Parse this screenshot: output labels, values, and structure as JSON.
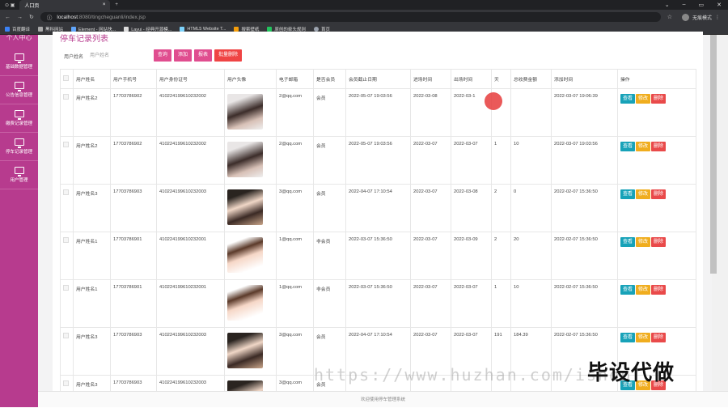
{
  "browser": {
    "tab_title": "人口页",
    "url_host": "localhost",
    "url_rest": ":8080/tingcheguanli/index.jsp",
    "profile_label": "无痕模式",
    "bookmarks": [
      "百度翻译",
      "黑科网站",
      "Element - 网站快...",
      "Layui - 经典开源模...",
      "HTML5 Website T...",
      "搜索壁纸",
      "原创的牵头规则",
      "首页"
    ]
  },
  "sidebar": {
    "top_label": "个人中心",
    "items": [
      {
        "label": "基础数据管理"
      },
      {
        "label": "公告信息管理"
      },
      {
        "label": "缴费记录管理"
      },
      {
        "label": "停车记录管理"
      },
      {
        "label": "用户管理"
      }
    ]
  },
  "page": {
    "title": "停车记录列表",
    "search_label": "用户姓名",
    "search_placeholder": "用户姓名",
    "buttons": {
      "search": "查询",
      "add": "添加",
      "report": "报表",
      "batch_delete": "批量删除"
    }
  },
  "table": {
    "headers": [
      "用户姓名",
      "用户手机号",
      "用户身份证号",
      "用户头像",
      "电子邮箱",
      "是否会员",
      "会员截止日期",
      "进场时间",
      "出场时间",
      "天",
      "总收费金额",
      "添加时间",
      "操作"
    ],
    "row_actions": {
      "view": "查看",
      "edit": "修改",
      "delete": "删除"
    },
    "rows": [
      {
        "name": "用户姓名2",
        "phone": "17703786902",
        "idcard": "410224199610232002",
        "avatar": "ph1",
        "email": "2@qq.com",
        "member": "会员",
        "member_end": "2022-05-07 19:03:56",
        "enter": "2022-03-08",
        "exit": "2022-03-1",
        "days": "",
        "fee": "",
        "added": "2022-03-07 19:06:39"
      },
      {
        "name": "用户姓名2",
        "phone": "17703786902",
        "idcard": "410224199610232002",
        "avatar": "ph1",
        "email": "2@qq.com",
        "member": "会员",
        "member_end": "2022-05-07 19:03:56",
        "enter": "2022-03-07",
        "exit": "2022-03-07",
        "days": "1",
        "fee": "10",
        "added": "2022-03-07 19:03:56"
      },
      {
        "name": "用户姓名3",
        "phone": "17703786903",
        "idcard": "410224199610232003",
        "avatar": "ph2",
        "email": "3@qq.com",
        "member": "会员",
        "member_end": "2022-04-07 17:10:54",
        "enter": "2022-03-07",
        "exit": "2022-03-08",
        "days": "2",
        "fee": "0",
        "added": "2022-02-07 15:36:50"
      },
      {
        "name": "用户姓名1",
        "phone": "17703786901",
        "idcard": "410224199610232001",
        "avatar": "ph3",
        "email": "1@qq.com",
        "member": "非会员",
        "member_end": "2022-03-07 15:36:50",
        "enter": "2022-03-07",
        "exit": "2022-03-09",
        "days": "2",
        "fee": "20",
        "added": "2022-02-07 15:36:50"
      },
      {
        "name": "用户姓名1",
        "phone": "17703786901",
        "idcard": "410224199610232001",
        "avatar": "ph3",
        "email": "1@qq.com",
        "member": "非会员",
        "member_end": "2022-03-07 15:36:50",
        "enter": "2022-03-07",
        "exit": "2022-03-07",
        "days": "1",
        "fee": "10",
        "added": "2022-02-07 15:36:50"
      },
      {
        "name": "用户姓名3",
        "phone": "17703786903",
        "idcard": "410224199610232003",
        "avatar": "ph2",
        "email": "3@qq.com",
        "member": "会员",
        "member_end": "2022-04-07 17:10:54",
        "enter": "2022-03-07",
        "exit": "2022-03-07",
        "days": "191",
        "fee": "184.39",
        "added": "2022-02-07 15:36:50"
      },
      {
        "name": "用户姓名3",
        "phone": "17703786903",
        "idcard": "410224199610232003",
        "avatar": "ph2",
        "email": "3@qq.com",
        "member": "会员",
        "member_end": "",
        "enter": "",
        "exit": "",
        "days": "",
        "fee": "",
        "added": ""
      }
    ]
  },
  "footer": {
    "text": "欢迎使用停车管理系统"
  },
  "watermark": {
    "url": "https://www.huzhan.com/ishop",
    "text": "毕设代做"
  },
  "colors": {
    "accent": "#b73b8e",
    "button": "#e04d8f",
    "danger": "#ef4444",
    "view": "#17a2b8",
    "edit": "#f0ad1e",
    "delete": "#e94a4a"
  }
}
